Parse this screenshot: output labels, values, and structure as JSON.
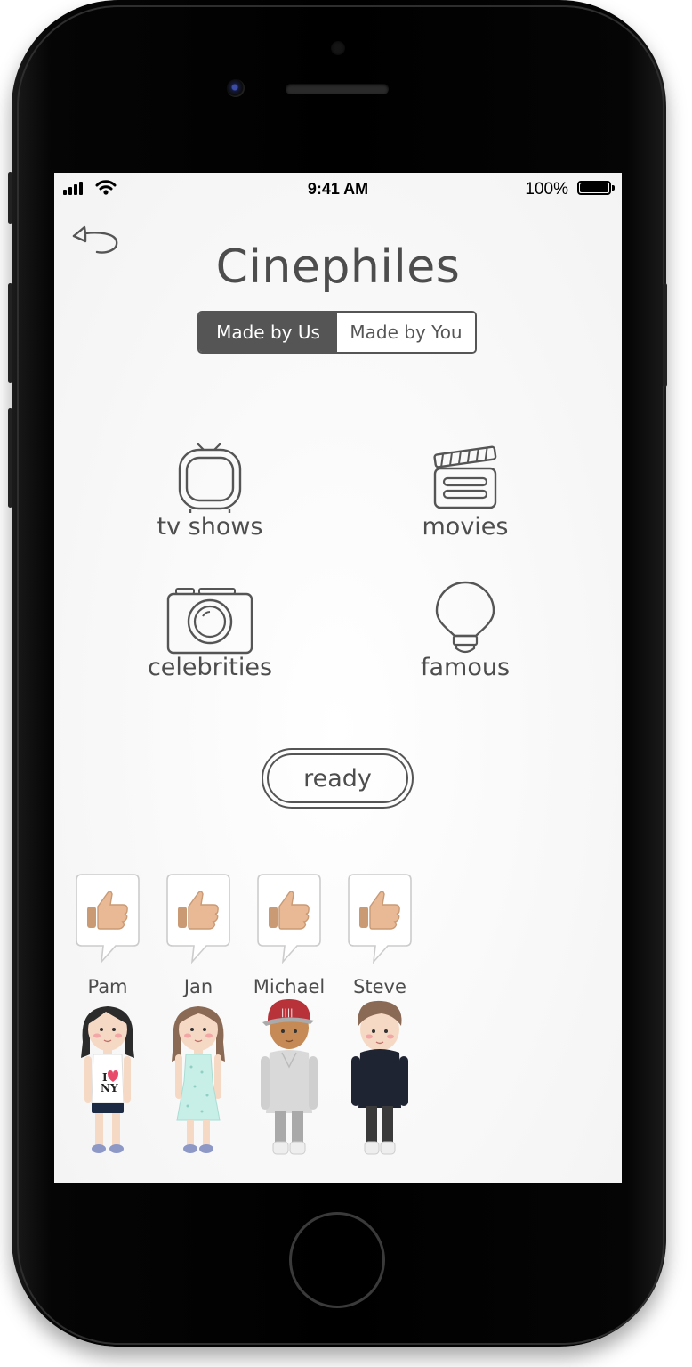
{
  "status_bar": {
    "time": "9:41 AM",
    "battery": "100%"
  },
  "title": "Cinephiles",
  "segments": [
    {
      "label": "Made by Us",
      "active": true
    },
    {
      "label": "Made by You",
      "active": false
    }
  ],
  "categories": [
    {
      "label": "tv shows",
      "icon": "tv-icon"
    },
    {
      "label": "movies",
      "icon": "clapperboard-icon"
    },
    {
      "label": "celebrities",
      "icon": "camera-icon"
    },
    {
      "label": "famous",
      "icon": "lightbulb-icon"
    }
  ],
  "ready_label": "ready",
  "players": [
    {
      "name": "Pam",
      "reaction": "thumbs-up",
      "shirt": "I ❤ NY"
    },
    {
      "name": "Jan",
      "reaction": "thumbs-up"
    },
    {
      "name": "Michael",
      "reaction": "thumbs-up"
    },
    {
      "name": "Steve",
      "reaction": "thumbs-up"
    }
  ],
  "colors": {
    "ink": "#4d4d4d",
    "segment_active": "#555555",
    "heart": "#e84a6a"
  }
}
